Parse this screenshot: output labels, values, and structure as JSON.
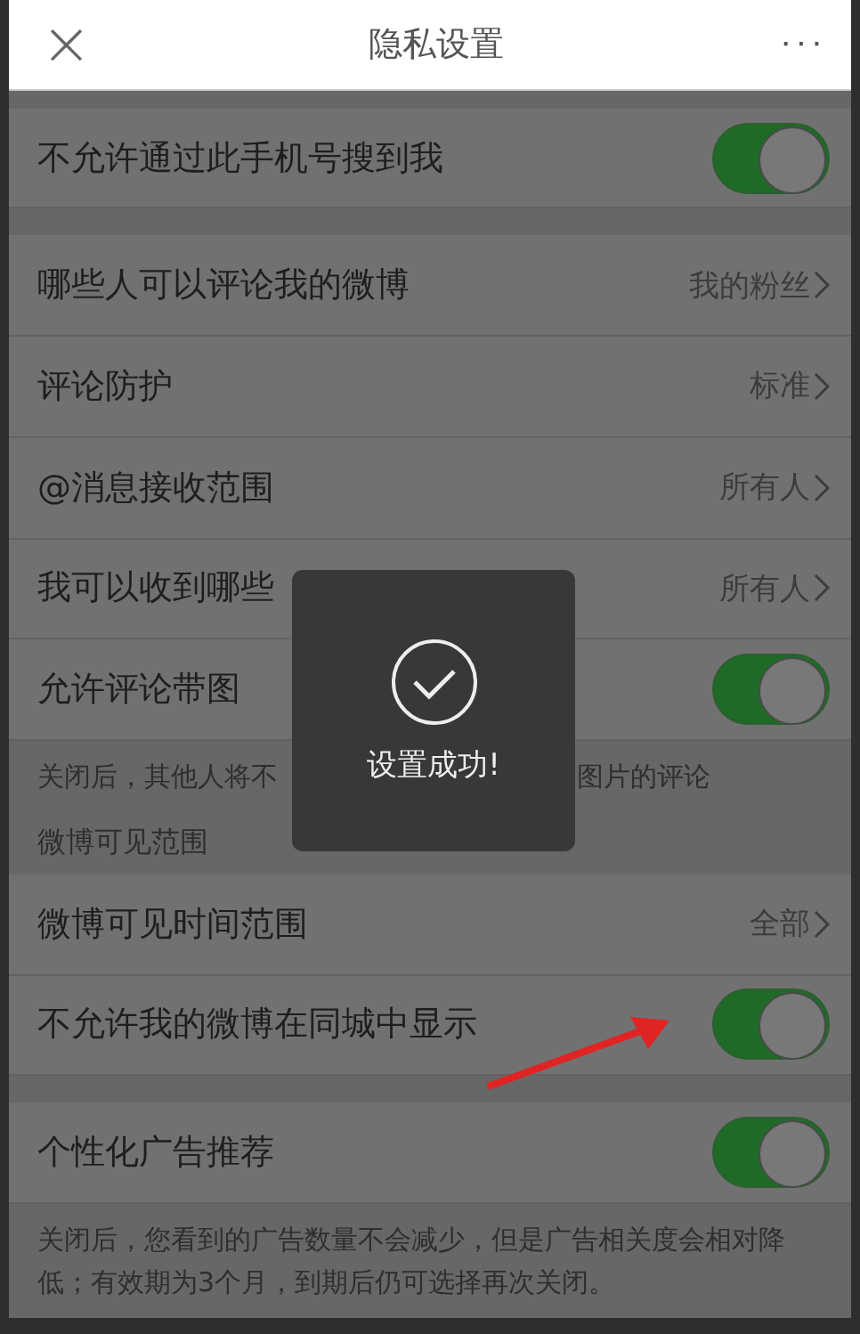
{
  "header": {
    "title": "隐私设置",
    "close": "×",
    "more": "···"
  },
  "sections": [
    {
      "kind": "group",
      "rows": [
        {
          "kind": "toggle",
          "label": "不允许通过此手机号搜到我",
          "on": true
        }
      ]
    },
    {
      "kind": "group",
      "rows": [
        {
          "kind": "link",
          "label": "哪些人可以评论我的微博",
          "value": "我的粉丝"
        },
        {
          "kind": "link",
          "label": "评论防护",
          "value": "标准"
        },
        {
          "kind": "link",
          "label": "@消息接收范围",
          "value": "所有人"
        },
        {
          "kind": "link",
          "label": "我可以收到哪些",
          "value": "所有人"
        },
        {
          "kind": "toggle",
          "label": "允许评论带图",
          "on": true
        }
      ],
      "note": [
        "关闭后，其他人将不",
        "图片的评论"
      ]
    },
    {
      "kind": "titled",
      "title": "微博可见范围",
      "rows": [
        {
          "kind": "link",
          "label": "微博可见时间范围",
          "value": "全部"
        },
        {
          "kind": "toggle",
          "label": "不允许我的微博在同城中显示",
          "on": true
        }
      ]
    },
    {
      "kind": "group",
      "rows": [
        {
          "kind": "toggle",
          "label": "个性化广告推荐",
          "on": true
        }
      ],
      "note": [
        "关闭后，您看到的广告数量不会减少，但是广告相关度会相对降低；有效期为3个月，到期后仍可选择再次关闭。"
      ]
    }
  ],
  "toast": {
    "message": "设置成功!"
  }
}
